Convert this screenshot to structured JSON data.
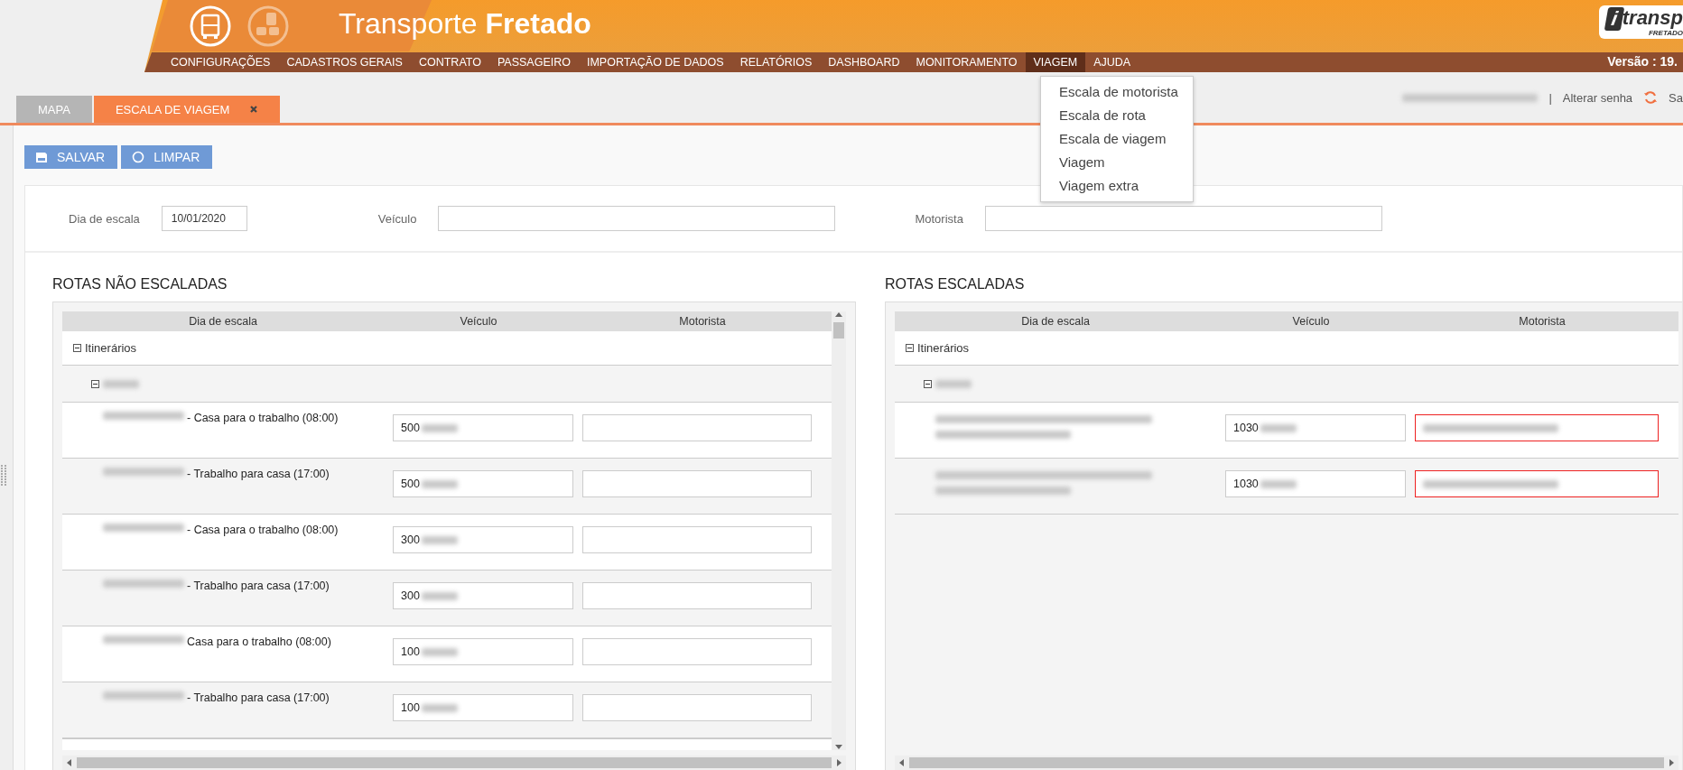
{
  "header": {
    "title_light": "Transporte",
    "title_bold": "Fretado",
    "logo_mark": "i",
    "logo_text": "transp",
    "logo_subtitle": "FRETADO"
  },
  "menu": [
    {
      "label": "CONFIGURAÇÕES",
      "selected": false
    },
    {
      "label": "CADASTROS GERAIS",
      "selected": false
    },
    {
      "label": "CONTRATO",
      "selected": false
    },
    {
      "label": "PASSAGEIRO",
      "selected": false
    },
    {
      "label": "IMPORTAÇÃO DE DADOS",
      "selected": false
    },
    {
      "label": "RELATÓRIOS",
      "selected": false
    },
    {
      "label": "DASHBOARD",
      "selected": false
    },
    {
      "label": "MONITORAMENTO",
      "selected": false
    },
    {
      "label": "VIAGEM",
      "selected": true
    },
    {
      "label": "AJUDA",
      "selected": false
    }
  ],
  "version": "Versão : 19.",
  "dropdown": [
    "Escala de motorista",
    "Escala de rota",
    "Escala de viagem",
    "Viagem",
    "Viagem extra"
  ],
  "tabs": [
    {
      "label": "MAPA",
      "selected": false,
      "closable": false
    },
    {
      "label": "ESCALA DE VIAGEM",
      "selected": true,
      "closable": true
    }
  ],
  "user_bar": {
    "separator": "|",
    "change_password": "Alterar senha",
    "logout": "Sa"
  },
  "toolbar": [
    {
      "label": "SALVAR",
      "kind": "save"
    },
    {
      "label": "LIMPAR",
      "kind": "clear"
    }
  ],
  "filters": [
    {
      "label": "Dia de escala",
      "value": "10/01/2020",
      "kind": "short"
    },
    {
      "label": "Veículo",
      "kind": "long"
    },
    {
      "label": "Motorista",
      "kind": "long"
    }
  ],
  "panels": [
    {
      "title": "ROTAS NÃO ESCALADAS",
      "columns": [
        "Dia de escala",
        "Veículo",
        "Motorista"
      ],
      "more_below": true,
      "tree": {
        "label": "Itinerários",
        "expanded": true,
        "children": [
          {
            "expanded": true,
            "children": [
              {
                "route": "- Casa para o trabalho (08:00)",
                "vehicle": "500",
                "driver_error": false,
                "driver_redacted": false
              },
              {
                "route": "- Trabalho para casa (17:00)",
                "vehicle": "500",
                "driver_error": false,
                "driver_redacted": false
              },
              {
                "route": "- Casa para o trabalho (08:00)",
                "vehicle": "300",
                "driver_error": false,
                "driver_redacted": false
              },
              {
                "route": "- Trabalho para casa (17:00)",
                "vehicle": "300",
                "driver_error": false,
                "driver_redacted": false
              },
              {
                "route": "Casa para o trabalho (08:00)",
                "vehicle": "100",
                "driver_error": false,
                "driver_redacted": false
              },
              {
                "route": "- Trabalho para casa (17:00)",
                "vehicle": "100",
                "driver_error": false,
                "driver_redacted": false
              }
            ]
          }
        ]
      }
    },
    {
      "title": "ROTAS ESCALADAS",
      "columns": [
        "Dia de escala",
        "Veículo",
        "Motorista"
      ],
      "more_below": false,
      "tree": {
        "label": "Itinerários",
        "expanded": true,
        "children": [
          {
            "expanded": true,
            "children": [
              {
                "vehicle": "1030",
                "driver_error": true,
                "driver_redacted": true
              },
              {
                "vehicle": "1030",
                "driver_error": true,
                "driver_redacted": true
              }
            ]
          }
        ]
      }
    }
  ]
}
